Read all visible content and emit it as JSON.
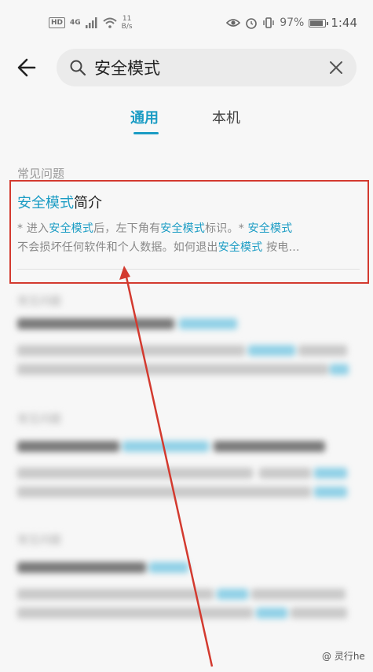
{
  "status_bar": {
    "hd": "HD",
    "network": "4G",
    "speed_value": "11",
    "speed_unit": "B/s",
    "battery": "97%",
    "battery_level": 0.97,
    "time": "1:44"
  },
  "search": {
    "query": "安全模式"
  },
  "tabs": [
    {
      "label": "通用",
      "active": true
    },
    {
      "label": "本机",
      "active": false
    }
  ],
  "section_label": "常见问题",
  "result": {
    "title_highlight": "安全模式",
    "title_rest": "简介",
    "line1": {
      "p1": "* 进入",
      "h1": "安全模式",
      "p2": "后，左下角有",
      "h2": "安全模式",
      "p3": "标识。* ",
      "h3": "安全模式"
    },
    "line2": {
      "p1": "不会损坏任何软件和个人数据。如何退出",
      "h1": "安全模式",
      "p2": " 按电…"
    }
  },
  "blurred": {
    "section_label_1": "常见问题",
    "section_label_2": "常见问题",
    "section_label_3": "常见问题"
  },
  "watermark": "@ 灵行he",
  "colors": {
    "accent": "#1b9cc4",
    "highlight_box": "#d33a2f",
    "arrow": "#d33a2f"
  },
  "icons": [
    "back-arrow-icon",
    "search-icon",
    "clear-icon",
    "wifi-icon",
    "signal-icon",
    "eye-icon",
    "alarm-icon",
    "vibrate-icon",
    "battery-icon"
  ]
}
